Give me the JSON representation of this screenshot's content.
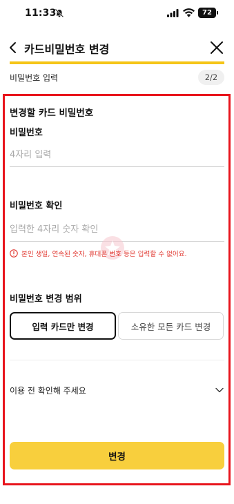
{
  "status_bar": {
    "time": "11:33",
    "battery_level": "72"
  },
  "header": {
    "title": "카드비밀번호 변경"
  },
  "progress": {
    "fraction": 1.0
  },
  "step": {
    "label": "비밀번호 입력",
    "badge": "2/2"
  },
  "form": {
    "section_title": "변경할 카드 비밀번호",
    "password": {
      "label": "비밀번호",
      "placeholder": "4자리 입력",
      "value": ""
    },
    "password_confirm": {
      "label": "비밀번호 확인",
      "placeholder": "입력한 4자리 숫자 확인",
      "value": ""
    },
    "error_message": "본인 생일, 연속된 숫자, 휴대폰 번호 등은 입력할 수 없어요."
  },
  "scope": {
    "title": "비밀번호 변경 범위",
    "options": [
      {
        "label": "입력 카드만 변경",
        "selected": true
      },
      {
        "label": "소유한 모든 카드 변경",
        "selected": false
      }
    ]
  },
  "notice": {
    "label": "이용 전 확인해 주세요",
    "icon": "chevron-down-icon"
  },
  "submit": {
    "label": "변경"
  },
  "colors": {
    "accent": "#f8cf3d",
    "progress": "#f5c518",
    "error": "#e0362e",
    "highlight_border": "#e8141c"
  }
}
